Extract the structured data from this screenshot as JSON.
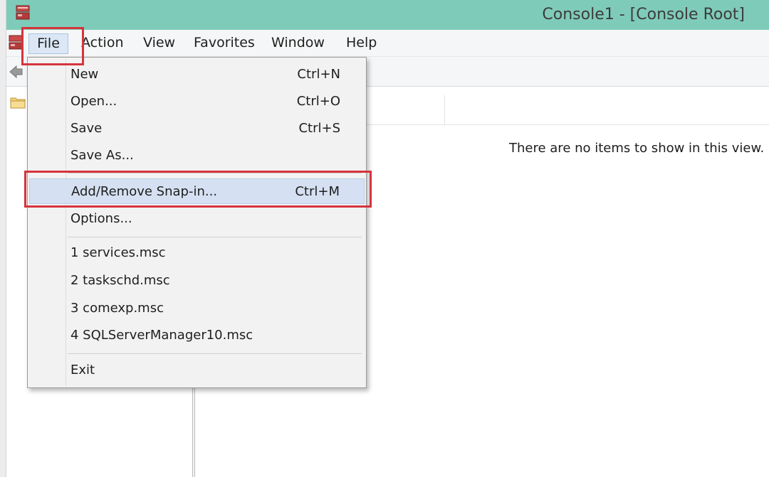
{
  "window": {
    "title": "Console1 - [Console Root]"
  },
  "menubar": {
    "items": [
      {
        "label": "File"
      },
      {
        "label": "Action"
      },
      {
        "label": "View"
      },
      {
        "label": "Favorites"
      },
      {
        "label": "Window"
      },
      {
        "label": "Help"
      }
    ]
  },
  "file_menu": {
    "items": [
      {
        "label": "New",
        "shortcut": "Ctrl+N"
      },
      {
        "label": "Open...",
        "shortcut": "Ctrl+O"
      },
      {
        "label": "Save",
        "shortcut": "Ctrl+S"
      },
      {
        "label": "Save As...",
        "shortcut": ""
      },
      {
        "label": "Add/Remove Snap-in...",
        "shortcut": "Ctrl+M",
        "highlighted": true
      },
      {
        "label": "Options...",
        "shortcut": ""
      },
      {
        "label": "1 services.msc",
        "shortcut": ""
      },
      {
        "label": "2 taskschd.msc",
        "shortcut": ""
      },
      {
        "label": "3 comexp.msc",
        "shortcut": ""
      },
      {
        "label": "4 SQLServerManager10.msc",
        "shortcut": ""
      },
      {
        "label": "Exit",
        "shortcut": ""
      }
    ]
  },
  "main": {
    "empty_message": "There are no items to show in this view."
  },
  "icons": {
    "app": "mmc-console-icon",
    "back": "back-arrow-icon",
    "tree_root": "folder-icon"
  },
  "colors": {
    "titlebar": "#7fcbb9",
    "menu_highlight": "#d5e1f2",
    "annotation": "#d6333c"
  }
}
